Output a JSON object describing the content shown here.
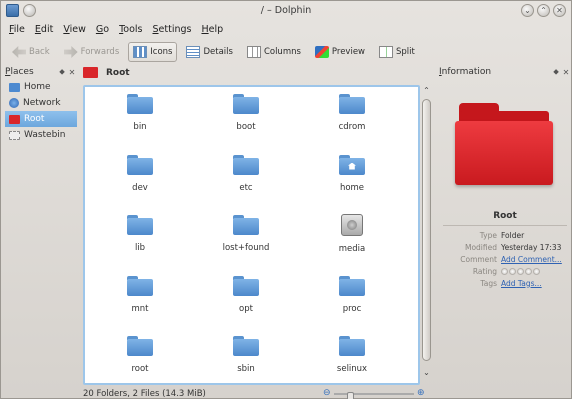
{
  "window": {
    "title": "/ – Dolphin"
  },
  "menu": [
    "File",
    "Edit",
    "View",
    "Go",
    "Tools",
    "Settings",
    "Help"
  ],
  "toolbar": {
    "back": "Back",
    "forward": "Forwards",
    "icons": "Icons",
    "details": "Details",
    "columns": "Columns",
    "preview": "Preview",
    "split": "Split"
  },
  "places": {
    "title": "Places",
    "items": [
      "Home",
      "Network",
      "Root",
      "Wastebin"
    ]
  },
  "location": {
    "label": "Root"
  },
  "files": [
    {
      "name": "bin",
      "icon": "folder-icon"
    },
    {
      "name": "boot",
      "icon": "folder-icon"
    },
    {
      "name": "cdrom",
      "icon": "folder-icon"
    },
    {
      "name": "dev",
      "icon": "folder-icon"
    },
    {
      "name": "etc",
      "icon": "folder-icon"
    },
    {
      "name": "home",
      "icon": "home-folder-icon"
    },
    {
      "name": "lib",
      "icon": "folder-icon"
    },
    {
      "name": "lost+found",
      "icon": "folder-icon"
    },
    {
      "name": "media",
      "icon": "drive-icon"
    },
    {
      "name": "mnt",
      "icon": "folder-icon"
    },
    {
      "name": "opt",
      "icon": "folder-icon"
    },
    {
      "name": "proc",
      "icon": "folder-icon"
    },
    {
      "name": "root",
      "icon": "folder-icon"
    },
    {
      "name": "sbin",
      "icon": "folder-icon"
    },
    {
      "name": "selinux",
      "icon": "folder-icon"
    }
  ],
  "status": {
    "text": "20 Folders, 2 Files (14.3 MiB)"
  },
  "zoom": {
    "level": 0.2
  },
  "info": {
    "title": "Information",
    "name": "Root",
    "type_label": "Type",
    "type_value": "Folder",
    "modified_label": "Modified",
    "modified_value": "Yesterday 17:33",
    "comment_label": "Comment",
    "comment_value": "Add Comment...",
    "rating_label": "Rating",
    "tags_label": "Tags",
    "tags_value": "Add Tags..."
  },
  "colors": {
    "accent": "#6da7dd",
    "folder_blue": "#4c88cb",
    "root_red": "#d9262a",
    "link": "#2f62b3"
  }
}
